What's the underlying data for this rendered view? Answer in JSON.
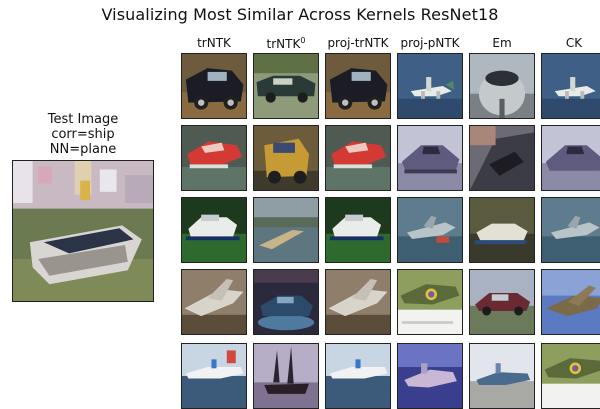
{
  "title": "Visualizing Most Similar Across Kernels ResNet18",
  "test": {
    "label_line1": "Test Image",
    "label_line2": "corr=ship",
    "label_line3": "NN=plane"
  },
  "columns": [
    {
      "label": "trNTK",
      "sup": ""
    },
    {
      "label": "trNTK",
      "sup": "0"
    },
    {
      "label": "proj-trNTK",
      "sup": ""
    },
    {
      "label": "proj-pNTK",
      "sup": ""
    },
    {
      "label": "Em",
      "sup": ""
    },
    {
      "label": "CK",
      "sup": ""
    }
  ]
}
